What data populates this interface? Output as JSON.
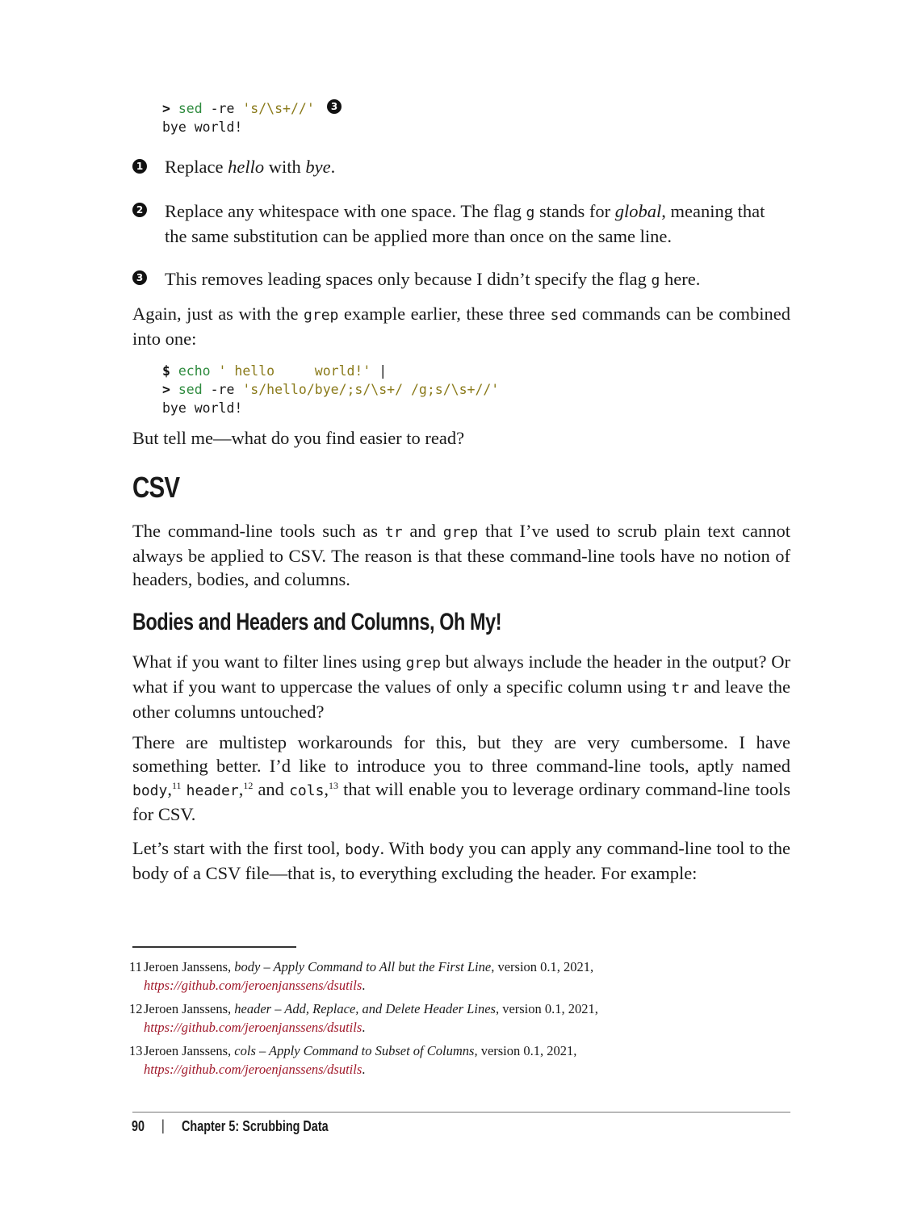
{
  "code_top": {
    "prompt": ">",
    "cmd": "sed",
    "args": " -re ",
    "str": "'s/\\s+//'",
    "callout": "3",
    "output": "bye world!"
  },
  "notes": [
    {
      "callout": "1",
      "pre": "Replace ",
      "em1": "hello",
      "mid": " with ",
      "em2": "bye",
      "post": "."
    },
    {
      "callout": "2",
      "line1_pre": "Replace any whitespace with one space. The flag ",
      "code": "g",
      "line1_mid": " stands for ",
      "em": "global",
      "line1_post": ", meaning that",
      "line2": "the same substitution can be applied more than once on the same line."
    },
    {
      "callout": "3",
      "pre": "This removes leading spaces only because I didn’t specify the flag ",
      "code": "g",
      "post": " here."
    }
  ],
  "para_again": {
    "pre": "Again, just as with the ",
    "code1": "grep",
    "mid": " example earlier, these three ",
    "code2": "sed",
    "post": " commands can be combined into one:"
  },
  "code_combined": {
    "line1_prompt": "$",
    "line1_cmd": "echo",
    "line1_str": " ' hello     world!'",
    "line1_pipe": " |",
    "line2_prompt": ">",
    "line2_cmd": "sed",
    "line2_args": " -re ",
    "line2_str": "'s/hello/bye/;s/\\s+/ /g;s/\\s+//'",
    "output": "bye world!"
  },
  "para_tell": "But tell me—what do you find easier to read?",
  "heading_csv": "CSV",
  "para_csv": {
    "pre": "The command-line tools such as ",
    "code1": "tr",
    "mid": " and ",
    "code2": "grep",
    "post": " that I’ve used to scrub plain text cannot always be applied to CSV. The reason is that these command-line tools have no notion of headers, bodies, and columns."
  },
  "heading_bodies": "Bodies and Headers and Columns, Oh My!",
  "para_whatif": {
    "pre": "What if you want to filter lines using ",
    "code1": "grep",
    "mid": " but always include the header in the output? Or what if you want to uppercase the values of only a specific column using ",
    "code2": "tr",
    "post": " and leave the other columns untouched?"
  },
  "para_multistep": {
    "pre": "There are multistep workarounds for this, but they are very cumbersome. I have something better. I’d like to introduce you to three command-line tools, aptly named ",
    "code1": "body",
    "sup1": "11",
    "code2": "header",
    "sup2": "12",
    "and": " and ",
    "code3": "cols",
    "sup3": "13",
    "post": " that will enable you to leverage ordinary command-line tools for CSV."
  },
  "para_letsstart": {
    "pre": "Let’s start with the first tool, ",
    "code1": "body",
    "mid": ". With ",
    "code2": "body",
    "post": " you can apply any command-line tool to the body of a CSV file—that is, to everything excluding the header. For example:"
  },
  "footnotes": [
    {
      "num": "11",
      "author": "Jeroen Janssens, ",
      "title": "body – Apply Command to All but the First Line",
      "rest": ", version 0.1, 2021, ",
      "url": "https://github.com/jeroenjanssens/dsutils"
    },
    {
      "num": "12",
      "author": "Jeroen Janssens, ",
      "title": "header – Add, Replace, and Delete Header Lines",
      "rest": ", version 0.1, 2021, ",
      "url": "https://github.com/jeroenjanssens/dsutils"
    },
    {
      "num": "13",
      "author": "Jeroen Janssens, ",
      "title": "cols – Apply Command to Subset of Columns",
      "rest": ", version 0.1, 2021, ",
      "url": "https://github.com/jeroenjanssens/dsutils"
    }
  ],
  "footer": {
    "page_number": "90",
    "separator": "|",
    "chapter": "Chapter 5: Scrubbing Data"
  }
}
